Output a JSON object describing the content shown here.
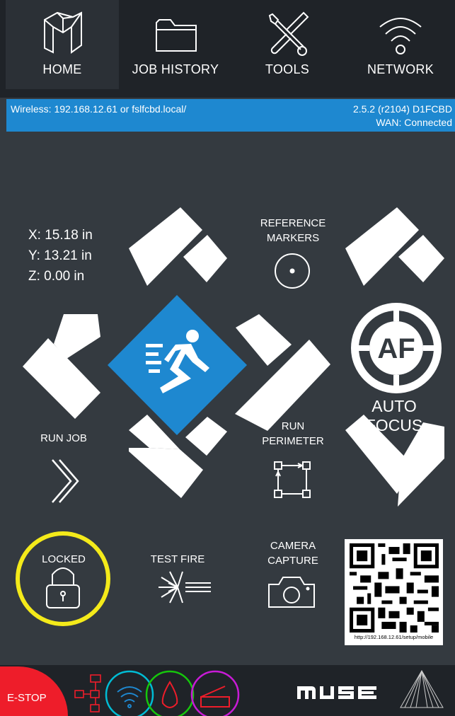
{
  "nav": {
    "tabs": [
      {
        "label": "HOME",
        "icon": "muse-logo-icon",
        "active": true
      },
      {
        "label": "JOB HISTORY",
        "icon": "folder-icon",
        "active": false
      },
      {
        "label": "TOOLS",
        "icon": "tools-icon",
        "active": false
      },
      {
        "label": "NETWORK",
        "icon": "wifi-icon",
        "active": false
      }
    ]
  },
  "status": {
    "wireless": "Wireless: 192.168.12.61  or fslfcbd.local/",
    "version": "2.5.2 (r2104)  D1FCBD",
    "wan": "WAN: Connected",
    "color": "#1e88d0"
  },
  "position": {
    "x": "X: 15.18 in",
    "y": "Y: 13.21 in",
    "z": "Z: 0.00 in"
  },
  "controls": {
    "reference_markers": "REFERENCE\nMARKERS",
    "auto_focus": "AUTO FOCUS",
    "af_badge": "AF",
    "run_job": "RUN JOB",
    "run_perimeter": "RUN\nPERIMETER",
    "locked": "LOCKED",
    "test_fire": "TEST FIRE",
    "camera_capture": "CAMERA\nCAPTURE",
    "qr_url": "http://192.168.12.61/setup/mobile",
    "home_color": "#1e88d0"
  },
  "bottom": {
    "estop": "E-STOP",
    "estop_color": "#ee1d2a",
    "brand": "muse",
    "status_icons": [
      "network-tree-icon",
      "wifi-icon",
      "water-drop-icon",
      "scanner-icon"
    ],
    "highlight_colors": [
      "#00bcd4",
      "#16c60c",
      "#c81bd6"
    ],
    "lock_highlight": "#f4ea1a"
  }
}
